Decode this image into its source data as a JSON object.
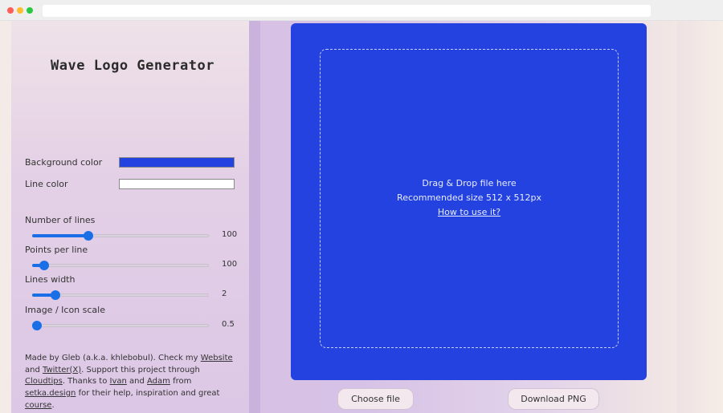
{
  "app": {
    "title": "Wave Logo Generator"
  },
  "colors": {
    "background_color_value": "#2342e0",
    "line_color_value": "#ffffff",
    "accent": "#1a6fe6"
  },
  "controls": {
    "background_color_label": "Background color",
    "line_color_label": "Line color",
    "sliders": [
      {
        "label": "Number of lines",
        "value": "100",
        "fraction": 0.32
      },
      {
        "label": "Points per line",
        "value": "100",
        "fraction": 0.07
      },
      {
        "label": "Lines width",
        "value": "2",
        "fraction": 0.13
      },
      {
        "label": "Image / Icon scale",
        "value": "0.5",
        "fraction": 0.02
      }
    ]
  },
  "credits": {
    "t1": "Made by Gleb (a.k.a. khlebobul). Check my ",
    "website": "Website",
    "t2": " and ",
    "twitter": "Twitter(X)",
    "t3": ". Support this project through ",
    "cloudtips": "Cloudtips",
    "t4": ". Thanks to ",
    "ivan": "Ivan",
    "t5": " and ",
    "adam": "Adam",
    "t6": " from ",
    "setka": "setka.design",
    "t7": " for their help, inspiration and great ",
    "course": "course",
    "t8": "."
  },
  "dropzone": {
    "line1": "Drag & Drop file here",
    "line2": "Recommended size 512 x 512px",
    "help_link": "How to use it?"
  },
  "buttons": {
    "choose_file": "Choose file",
    "download_png": "Download PNG"
  }
}
